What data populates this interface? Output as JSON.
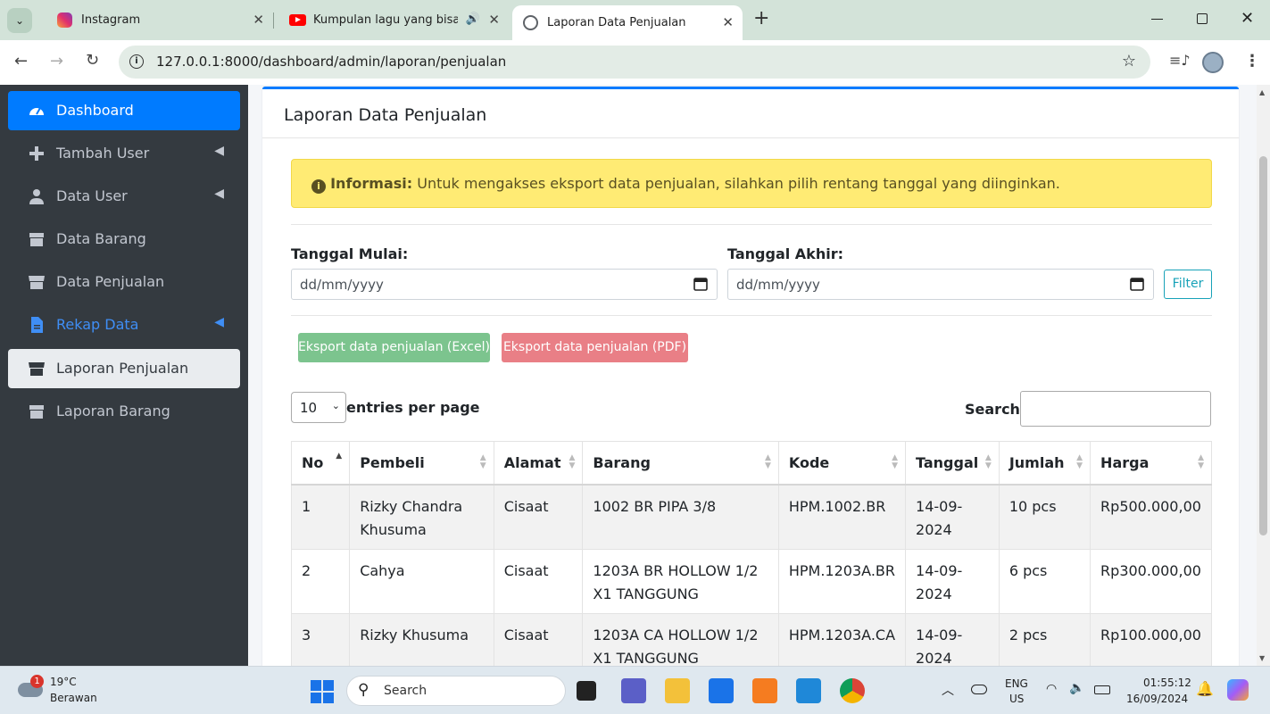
{
  "browser": {
    "tabs": [
      {
        "title": "Instagram"
      },
      {
        "title": "Kumpulan lagu yang bisa ar"
      },
      {
        "title": "Laporan Data Penjualan"
      }
    ],
    "url": "127.0.0.1:8000/dashboard/admin/laporan/penjualan"
  },
  "sidebar": {
    "items": [
      {
        "label": "Dashboard"
      },
      {
        "label": "Tambah User"
      },
      {
        "label": "Data User"
      },
      {
        "label": "Data Barang"
      },
      {
        "label": "Data Penjualan"
      },
      {
        "label": "Rekap Data"
      },
      {
        "label": "Laporan Penjualan"
      },
      {
        "label": "Laporan Barang"
      }
    ]
  },
  "card": {
    "title": "Laporan Data Penjualan",
    "alert_bold": "Informasi:",
    "alert_text": " Untuk mengakses eksport data penjualan, silahkan pilih rentang tanggal yang diinginkan.",
    "start_label": "Tanggal Mulai:",
    "end_label": "Tanggal Akhir:",
    "date_placeholder": "dd/mm/yyyy",
    "filter_label": "Filter",
    "export_excel": "Eksport data penjualan (Excel)",
    "export_pdf": "Eksport data penjualan (PDF)",
    "entries_value": "10",
    "entries_label": "entries per page",
    "search_label": "Search:"
  },
  "table": {
    "headers": [
      "No",
      "Pembeli",
      "Alamat",
      "Barang",
      "Kode",
      "Tanggal",
      "Jumlah",
      "Harga"
    ],
    "rows": [
      [
        "1",
        "Rizky Chandra Khusuma",
        "Cisaat",
        "1002 BR PIPA 3/8",
        "HPM.1002.BR",
        "14-09-2024",
        "10 pcs",
        "Rp500.000,00"
      ],
      [
        "2",
        "Cahya",
        "Cisaat",
        "1203A BR HOLLOW 1/2 X1 TANGGUNG",
        "HPM.1203A.BR",
        "14-09-2024",
        "6 pcs",
        "Rp300.000,00"
      ],
      [
        "3",
        "Rizky Khusuma",
        "Cisaat",
        "1203A CA HOLLOW 1/2 X1 TANGGUNG",
        "HPM.1203A.CA",
        "14-09-2024",
        "2 pcs",
        "Rp100.000,00"
      ]
    ]
  },
  "taskbar": {
    "weather_temp": "19°C",
    "weather_text": "Berawan",
    "weather_badge": "1",
    "search_label": "Search",
    "lang_top": "ENG",
    "lang_bottom": "US",
    "time": "01:55:12",
    "date": "16/09/2024"
  },
  "colors": {
    "primary": "#007bff",
    "sidebar_bg": "#343a40",
    "excel_btn": "#7cc48e",
    "pdf_btn": "#e97f86",
    "alert_bg": "#ffeb74"
  }
}
